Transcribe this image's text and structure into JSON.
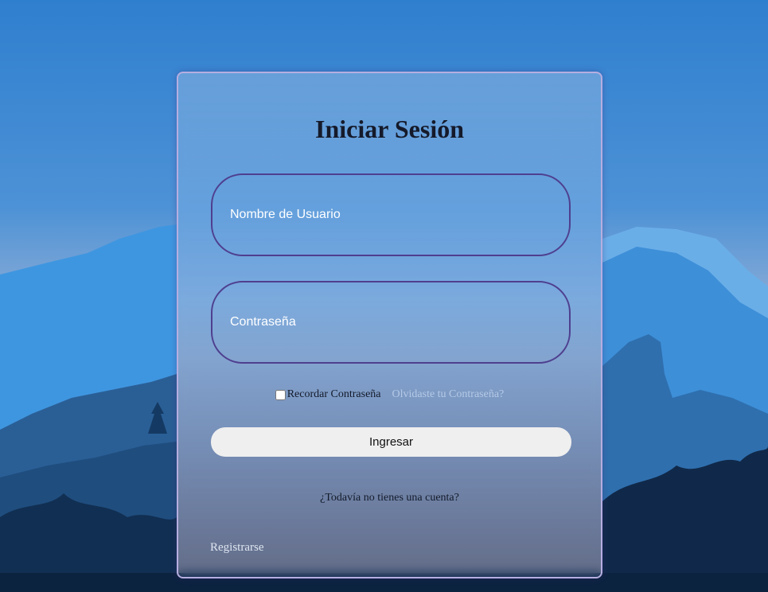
{
  "login": {
    "title": "Iniciar Sesión",
    "username_placeholder": "Nombre de Usuario",
    "password_placeholder": "Contraseña",
    "remember_label": "Recordar Contraseña",
    "forgot_link": "Olvidaste tu Contraseña?",
    "submit_label": "Ingresar",
    "no_account_text": "¿Todavía no tienes una cuenta?",
    "register_link": "Registrarse"
  },
  "colors": {
    "card_border": "#b6aee0",
    "field_border": "#4f3f8f",
    "button_bg": "#efefef",
    "forgot_link": "#b5c9e6"
  }
}
